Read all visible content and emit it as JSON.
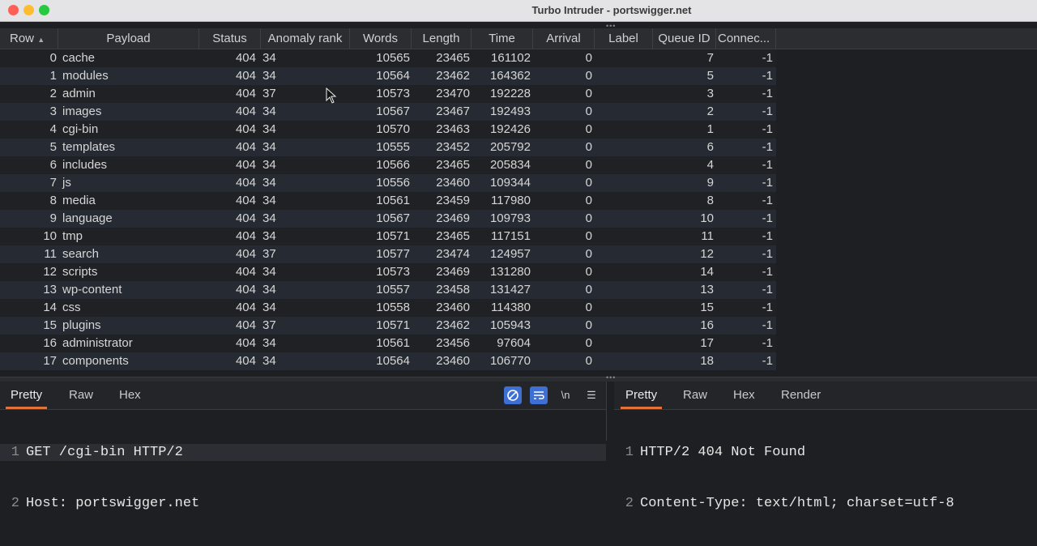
{
  "window": {
    "title": "Turbo Intruder - portswigger.net"
  },
  "table": {
    "columns": [
      "Row",
      "Payload",
      "Status",
      "Anomaly rank",
      "Words",
      "Length",
      "Time",
      "Arrival",
      "Label",
      "Queue ID",
      "Connec..."
    ],
    "rows": [
      [
        "0",
        "cache",
        "404",
        "34",
        "10565",
        "23465",
        "161102",
        "0",
        "",
        "7",
        "-1"
      ],
      [
        "1",
        "modules",
        "404",
        "34",
        "10564",
        "23462",
        "164362",
        "0",
        "",
        "5",
        "-1"
      ],
      [
        "2",
        "admin",
        "404",
        "37",
        "10573",
        "23470",
        "192228",
        "0",
        "",
        "3",
        "-1"
      ],
      [
        "3",
        "images",
        "404",
        "34",
        "10567",
        "23467",
        "192493",
        "0",
        "",
        "2",
        "-1"
      ],
      [
        "4",
        "cgi-bin",
        "404",
        "34",
        "10570",
        "23463",
        "192426",
        "0",
        "",
        "1",
        "-1"
      ],
      [
        "5",
        "templates",
        "404",
        "34",
        "10555",
        "23452",
        "205792",
        "0",
        "",
        "6",
        "-1"
      ],
      [
        "6",
        "includes",
        "404",
        "34",
        "10566",
        "23465",
        "205834",
        "0",
        "",
        "4",
        "-1"
      ],
      [
        "7",
        "js",
        "404",
        "34",
        "10556",
        "23460",
        "109344",
        "0",
        "",
        "9",
        "-1"
      ],
      [
        "8",
        "media",
        "404",
        "34",
        "10561",
        "23459",
        "117980",
        "0",
        "",
        "8",
        "-1"
      ],
      [
        "9",
        "language",
        "404",
        "34",
        "10567",
        "23469",
        "109793",
        "0",
        "",
        "10",
        "-1"
      ],
      [
        "10",
        "tmp",
        "404",
        "34",
        "10571",
        "23465",
        "117151",
        "0",
        "",
        "11",
        "-1"
      ],
      [
        "11",
        "search",
        "404",
        "37",
        "10577",
        "23474",
        "124957",
        "0",
        "",
        "12",
        "-1"
      ],
      [
        "12",
        "scripts",
        "404",
        "34",
        "10573",
        "23469",
        "131280",
        "0",
        "",
        "14",
        "-1"
      ],
      [
        "13",
        "wp-content",
        "404",
        "34",
        "10557",
        "23458",
        "131427",
        "0",
        "",
        "13",
        "-1"
      ],
      [
        "14",
        "css",
        "404",
        "34",
        "10558",
        "23460",
        "114380",
        "0",
        "",
        "15",
        "-1"
      ],
      [
        "15",
        "plugins",
        "404",
        "37",
        "10571",
        "23462",
        "105943",
        "0",
        "",
        "16",
        "-1"
      ],
      [
        "16",
        "administrator",
        "404",
        "34",
        "10561",
        "23456",
        "97604",
        "0",
        "",
        "17",
        "-1"
      ],
      [
        "17",
        "components",
        "404",
        "34",
        "10564",
        "23460",
        "106770",
        "0",
        "",
        "18",
        "-1"
      ]
    ]
  },
  "request_pane": {
    "tabs": [
      "Pretty",
      "Raw",
      "Hex"
    ],
    "tool_newline": "\\n",
    "lines": [
      {
        "num": "1",
        "text": "GET /cgi-bin HTTP/2"
      },
      {
        "num": "2",
        "text": "Host: portswigger.net"
      }
    ]
  },
  "response_pane": {
    "tabs": [
      "Pretty",
      "Raw",
      "Hex",
      "Render"
    ],
    "lines": [
      {
        "num": "1",
        "text": "HTTP/2 404 Not Found"
      },
      {
        "num": "2",
        "text": "Content-Type: text/html; charset=utf-8"
      }
    ]
  },
  "colors": {
    "accent_tab": "#e2723b",
    "tool_active": "#3d6fd4"
  }
}
